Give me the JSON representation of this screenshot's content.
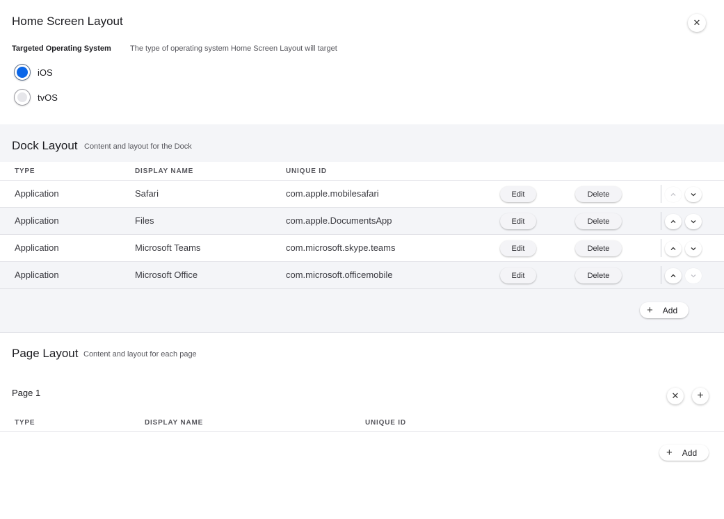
{
  "header": {
    "title": "Home Screen Layout",
    "close_symbol": "✕",
    "os_label": "Targeted Operating System",
    "os_description": "The type of operating system Home Screen Layout will target",
    "os_options": [
      {
        "label": "iOS",
        "selected": true
      },
      {
        "label": "tvOS",
        "selected": false
      }
    ]
  },
  "dock": {
    "title": "Dock Layout",
    "description": "Content and layout for the Dock",
    "columns": [
      "TYPE",
      "DISPLAY NAME",
      "UNIQUE ID"
    ],
    "rows": [
      {
        "type": "Application",
        "name": "Safari",
        "id": "com.apple.mobilesafari"
      },
      {
        "type": "Application",
        "name": "Files",
        "id": "com.apple.DocumentsApp"
      },
      {
        "type": "Application",
        "name": "Microsoft Teams",
        "id": "com.microsoft.skype.teams"
      },
      {
        "type": "Application",
        "name": "Microsoft Office",
        "id": "com.microsoft.officemobile"
      }
    ],
    "edit_label": "Edit",
    "delete_label": "Delete",
    "add_label": "Add",
    "add_symbol": "+"
  },
  "page": {
    "title": "Page Layout",
    "description": "Content and layout for each page",
    "page_label": "Page 1",
    "remove_symbol": "✕",
    "add_page_symbol": "+",
    "columns": [
      "TYPE",
      "DISPLAY NAME",
      "UNIQUE ID"
    ],
    "add_label": "Add",
    "add_symbol": "+"
  }
}
